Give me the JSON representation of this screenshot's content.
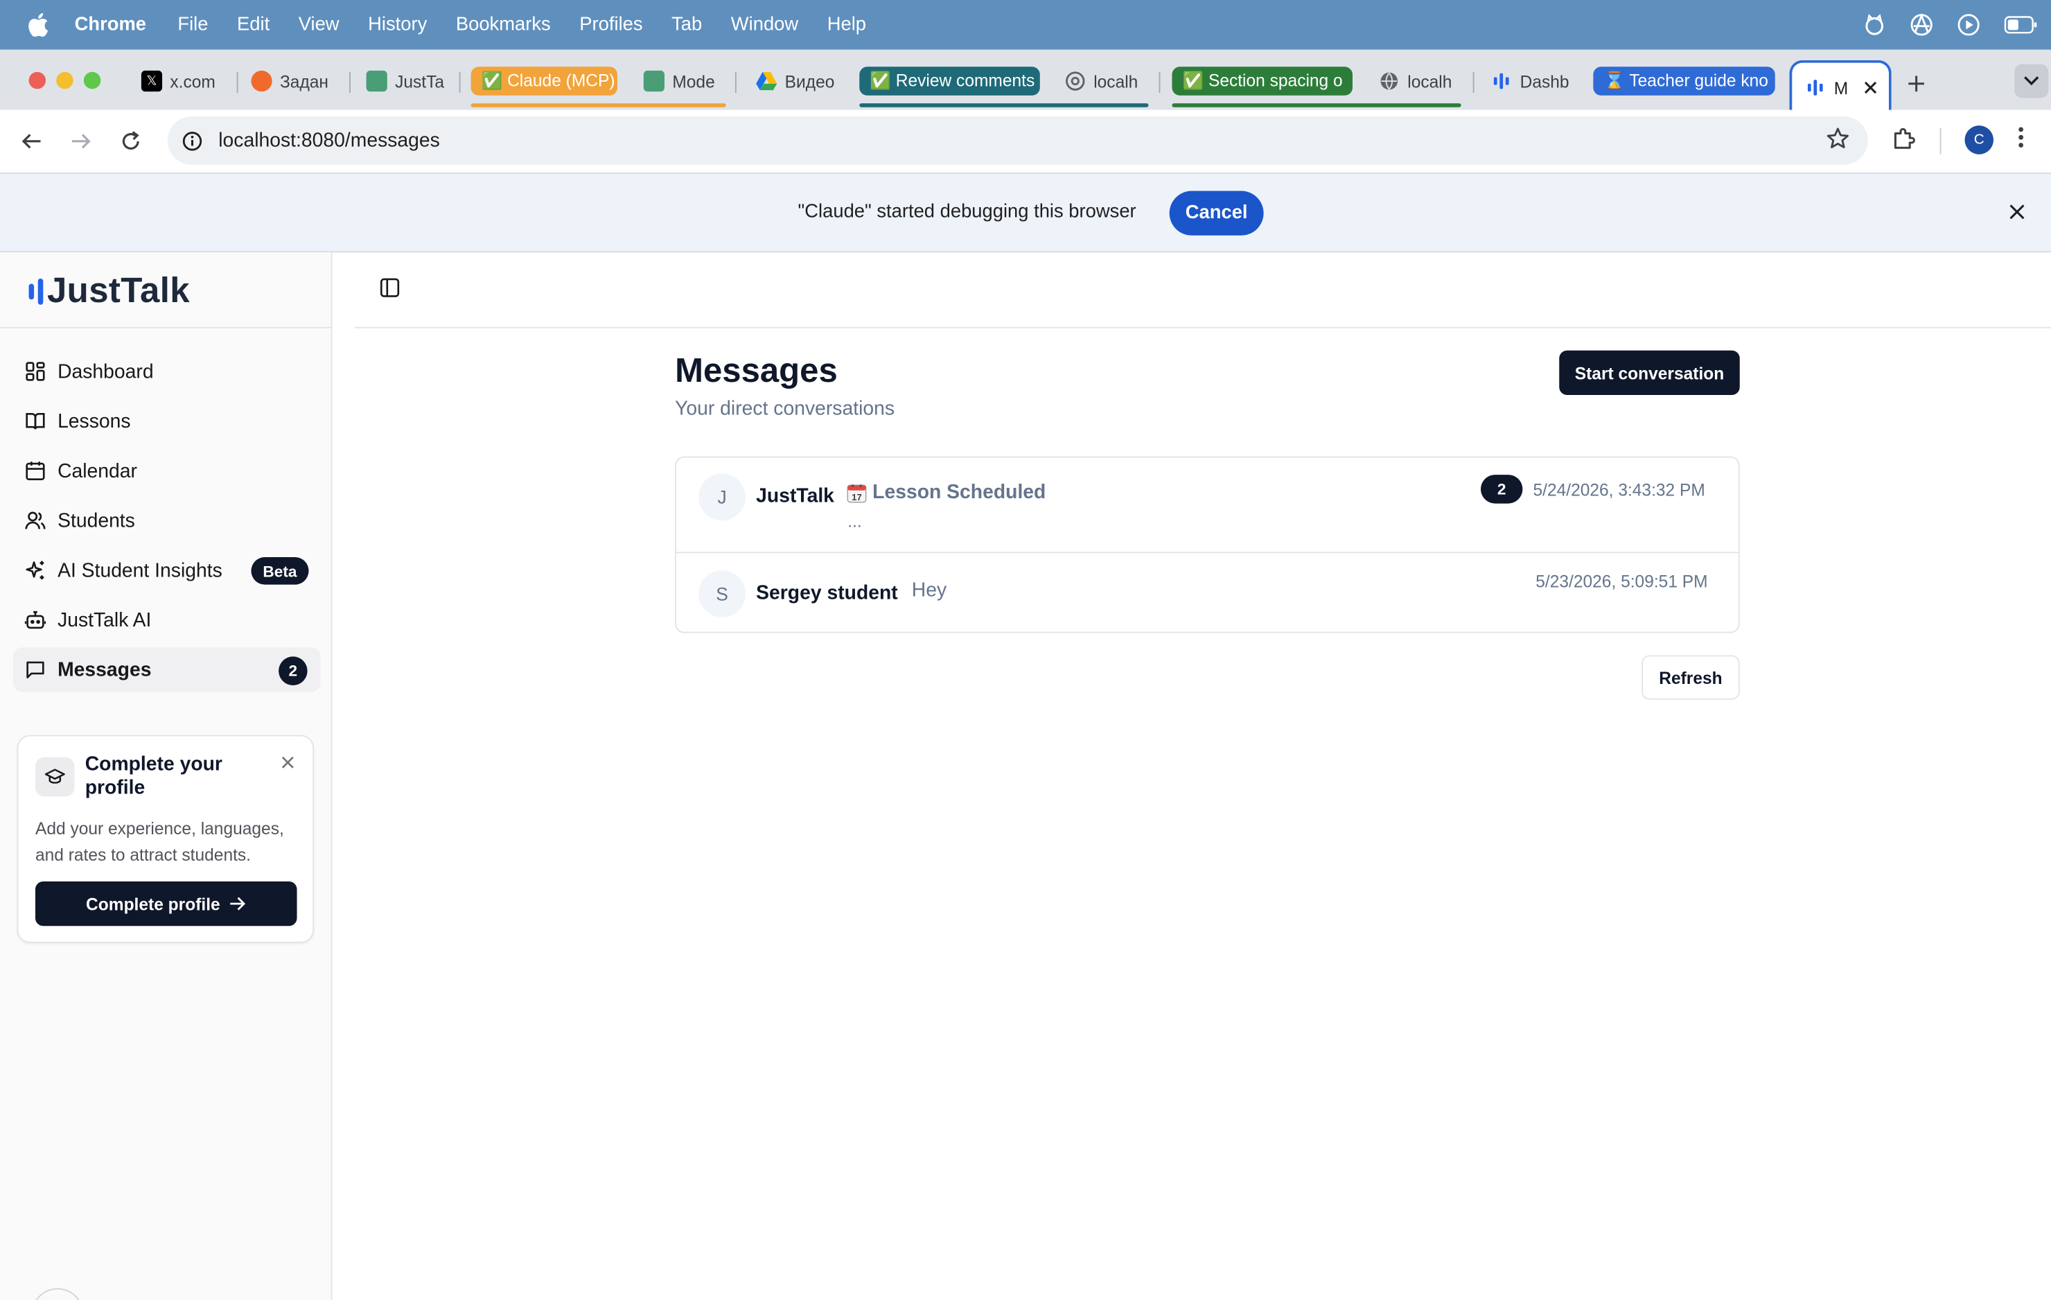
{
  "os_menubar": {
    "app_name": "Chrome",
    "menus": [
      "File",
      "Edit",
      "View",
      "History",
      "Bookmarks",
      "Profiles",
      "Tab",
      "Window",
      "Help"
    ]
  },
  "browser": {
    "tabs": [
      {
        "label": "x.com"
      },
      {
        "label": "Задан"
      },
      {
        "label": "JustTa"
      },
      {
        "label": "✅ Claude (MCP)",
        "group_color": "#f2a33a"
      },
      {
        "label": "Mode"
      },
      {
        "label": "Видео"
      },
      {
        "label": "✅ Review comments",
        "group_color": "#1f6a78"
      },
      {
        "label": "localh"
      },
      {
        "label": "✅ Section spacing o",
        "group_color": "#2d7d3a"
      },
      {
        "label": "localh"
      },
      {
        "label": "Dashb"
      },
      {
        "label": "⌛ Teacher guide kno",
        "group_color": "#2f6bd6"
      },
      {
        "label": "M",
        "active": true
      }
    ],
    "url": "localhost:8080/messages",
    "profile_initial": "C",
    "infobar": {
      "message": "\"Claude\" started debugging this browser",
      "cancel_label": "Cancel"
    }
  },
  "app": {
    "brand": "JustTalk",
    "brand_color": "#2563eb",
    "nav": [
      {
        "label": "Dashboard",
        "icon": "dashboard-icon"
      },
      {
        "label": "Lessons",
        "icon": "book-icon"
      },
      {
        "label": "Calendar",
        "icon": "calendar-icon"
      },
      {
        "label": "Students",
        "icon": "users-icon"
      },
      {
        "label": "AI Student Insights",
        "icon": "sparkles-icon",
        "badge": "Beta"
      },
      {
        "label": "JustTalk AI",
        "icon": "bot-icon"
      },
      {
        "label": "Messages",
        "icon": "message-icon",
        "count": "2",
        "active": true
      }
    ],
    "profile_card": {
      "title": "Complete your profile",
      "description": "Add your experience, languages, and rates to attract students.",
      "cta": "Complete profile"
    }
  },
  "page": {
    "title": "Messages",
    "subtitle": "Your direct conversations",
    "start_button": "Start conversation",
    "refresh_button": "Refresh",
    "conversations": [
      {
        "initial": "J",
        "name": "JustTalk",
        "preview": "Lesson Scheduled",
        "preview_line2": "...",
        "unread": "2",
        "timestamp": "5/24/2026, 3:43:32 PM"
      },
      {
        "initial": "S",
        "name": "Sergey student",
        "preview": "Hey",
        "timestamp": "5/23/2026, 5:09:51 PM"
      }
    ]
  }
}
